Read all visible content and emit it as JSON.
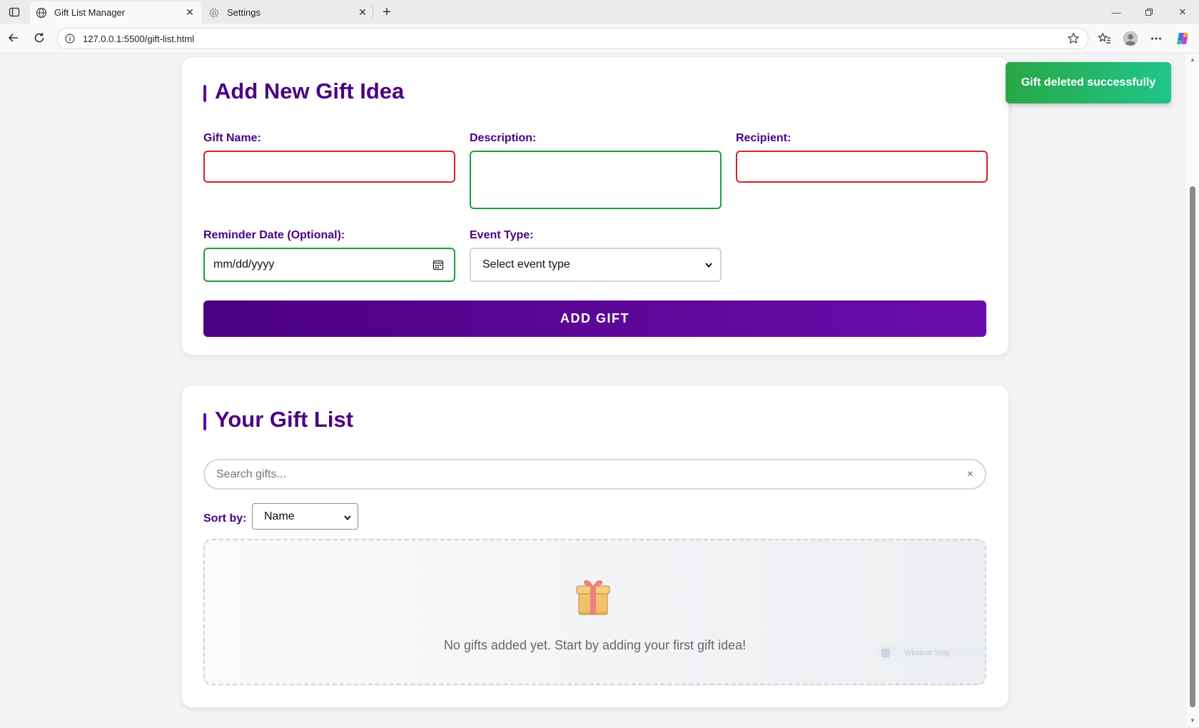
{
  "browser": {
    "tabs": [
      {
        "label": "Gift List Manager",
        "icon": "globe-icon",
        "active": true
      },
      {
        "label": "Settings",
        "icon": "gear-icon",
        "active": false
      }
    ],
    "url": "127.0.0.1:5500/gift-list.html"
  },
  "add_form": {
    "title": "Add New Gift Idea",
    "gift_name_label": "Gift Name:",
    "gift_name_value": "",
    "description_label": "Description:",
    "description_value": "",
    "recipient_label": "Recipient:",
    "recipient_value": "",
    "reminder_label": "Reminder Date (Optional):",
    "reminder_value": "mm/dd/yyyy",
    "event_type_label": "Event Type:",
    "event_type_value": "Select event type",
    "submit_label": "ADD GIFT"
  },
  "gift_list": {
    "title": "Your Gift List",
    "search_placeholder": "Search gifts...",
    "clear_symbol": "×",
    "sort_label": "Sort by:",
    "sort_value": "Name",
    "empty_message": "No gifts added yet. Start by adding your first gift idea!"
  },
  "toast": {
    "message": "Gift deleted successfully"
  },
  "overlay": {
    "snip_label": "Window Snip"
  },
  "colors": {
    "accent": "#4b0082",
    "invalid_border": "#d0222e",
    "valid_border": "#1e9e3a",
    "toast_bg": "#28a745"
  }
}
